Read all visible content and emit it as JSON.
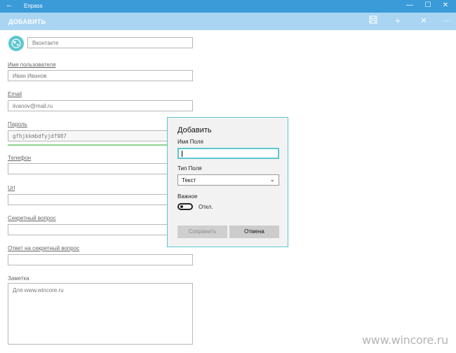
{
  "titlebar": {
    "app_name": "Enpass",
    "back_glyph": "←",
    "minimize_glyph": "—",
    "maximize_glyph": "☐",
    "close_glyph": "✕"
  },
  "appbar": {
    "heading": "ДОБАВИТЬ",
    "save_glyph": "🖫",
    "add_glyph": "+",
    "close_glyph": "✕",
    "more_glyph": "⋯"
  },
  "colors": {
    "titlebar": "#3a9bd8",
    "appbar": "#a9d5f2",
    "accent": "#5cc7cf",
    "strength": "#8ed38e"
  },
  "form": {
    "avatar_icon": "globe-icon",
    "avatar_glyph": "🌍",
    "title_value": "Вконтакте",
    "username_label": "Имя пользователя",
    "username_value": "Иван Иванов",
    "email_label": "Email",
    "email_value": "iivanov@mail.ru",
    "password_label": "Пароль",
    "password_value": "gfhjkkmbdfyjdf987",
    "phone_label": "Телефон",
    "phone_value": "",
    "url_label": "Url",
    "url_value": "",
    "question_label": "Секретный вопрос",
    "question_value": "",
    "answer_label": "Ответ на секретный вопрос",
    "answer_value": "",
    "note_label": "Заметка",
    "note_value": "Для www.wincore.ru"
  },
  "dialog": {
    "title": "Добавить",
    "field_name_label": "Имя Поля",
    "field_name_value": "",
    "field_type_label": "Тип Поля",
    "field_type_value": "Текст",
    "important_label": "Важное",
    "toggle_state": "Откл.",
    "save_label": "Сохранить",
    "cancel_label": "Отмена"
  },
  "watermark": "www.wincore.ru"
}
